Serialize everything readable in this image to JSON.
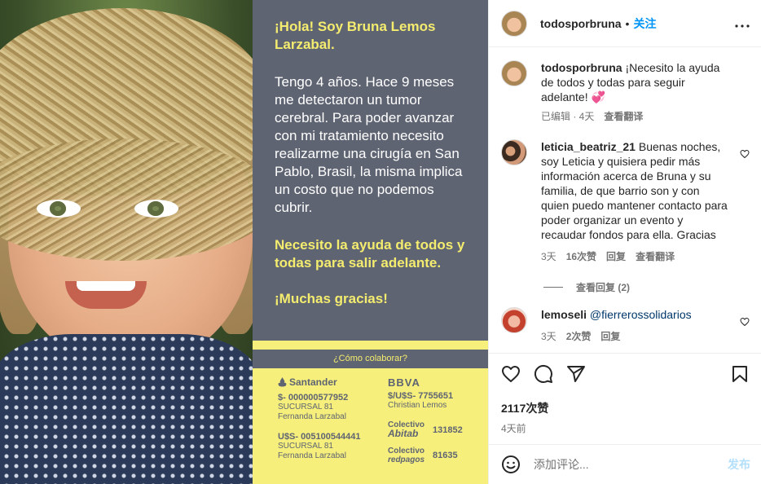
{
  "poster": {
    "greeting": "¡Hola! Soy Bruna Lemos Larzabal.",
    "body": "Tengo 4 años. Hace 9 meses me detectaron un tumor cerebral. Para poder avanzar con mi tratamiento necesito realizarme una cirugía en San Pablo, Brasil, la misma implica un costo que no podemos cubrir.",
    "help": "Necesito la ayuda de todos y todas para salir adelante.",
    "thanks": "¡Muchas gracias!",
    "how_to": "¿Cómo colaborar?",
    "santander": {
      "brand": "Santander",
      "peso_account": "$- 000000577952",
      "peso_branch": "SUCURSAL 81",
      "peso_holder": "Fernanda Larzabal",
      "usd_account": "U$S- 005100544441",
      "usd_branch": "SUCURSAL 81",
      "usd_holder": "Fernanda Larzabal"
    },
    "bbva": {
      "brand": "BBVA",
      "account": "$/U$S- 7755651",
      "holder": "Christian Lemos"
    },
    "abitab": {
      "label_top": "Colectivo",
      "label_bottom": "Abitab",
      "value": "131852"
    },
    "redpagos": {
      "label_top": "Colectivo",
      "label_bottom": "redpagos",
      "value": "81635"
    }
  },
  "header": {
    "username": "todosporbruna",
    "separator": "•",
    "follow_label": "关注",
    "more_icon": "more-horizontal-icon"
  },
  "caption": {
    "username": "todosporbruna",
    "text": "¡Necesito la ayuda de todos y todas para seguir adelante! 💞",
    "edited": "已编辑 · 4天",
    "translate": "查看翻译"
  },
  "comments": [
    {
      "username": "leticia_beatriz_21",
      "text": "Buenas noches, soy Leticia y quisiera pedir más información acerca de Bruna y su familia, de que barrio son y con quien puedo mantener contacto para poder organizar un evento y recaudar fondos para ella. Gracias",
      "time": "3天",
      "likes": "16次赞",
      "reply": "回复",
      "translate": "查看翻译",
      "view_replies": "查看回复 (2)"
    },
    {
      "username": "lemoseli",
      "mention": "@fierrerossolidarios",
      "time": "3天",
      "likes": "2次赞",
      "reply": "回复"
    }
  ],
  "actions": {
    "likes": "2117次赞",
    "ago": "4天前"
  },
  "compose": {
    "placeholder": "添加评论...",
    "post_label": "发布"
  },
  "colors": {
    "poster_gray": "#5f6473",
    "poster_yellow": "#f6ef7b",
    "follow_blue": "#0095f6",
    "post_blue_disabled": "#b2dffc"
  }
}
